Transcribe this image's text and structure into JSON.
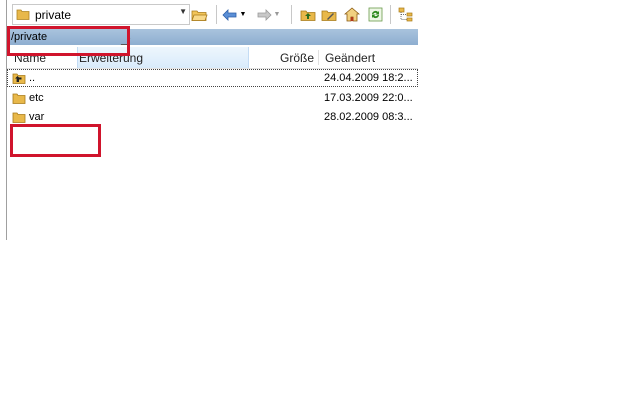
{
  "toolbar": {
    "path_value": "private",
    "icons": [
      "folder-icon",
      "open-folder-icon",
      "back-arrow-icon",
      "forward-arrow-icon",
      "parent-folder-icon",
      "new-folder-icon",
      "home-icon",
      "refresh-icon",
      "tree-view-icon"
    ]
  },
  "address_bar": {
    "path": "/private"
  },
  "columns": {
    "name": "Name",
    "extension": "Erweiterung",
    "size": "Größe",
    "modified": "Geändert"
  },
  "files": [
    {
      "name": "..",
      "modified": "24.04.2009 18:2...",
      "icon": "parent-folder-icon"
    },
    {
      "name": "etc",
      "modified": "17.03.2009 22:0...",
      "icon": "folder-icon"
    },
    {
      "name": "var",
      "modified": "28.02.2009 08:3...",
      "icon": "folder-icon"
    }
  ],
  "colors": {
    "annotation_red": "#d0142c",
    "address_bar": "#9cb8d6",
    "folder": "#e8b84a"
  }
}
